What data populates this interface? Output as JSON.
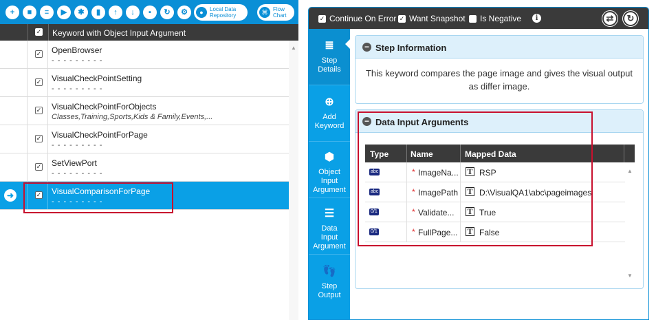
{
  "toolbar": {
    "buttons": [
      {
        "name": "add",
        "glyph": "+"
      },
      {
        "name": "record",
        "glyph": "■"
      },
      {
        "name": "list",
        "glyph": "≡"
      },
      {
        "name": "run",
        "glyph": "▶"
      },
      {
        "name": "debug",
        "glyph": "✱"
      },
      {
        "name": "delete",
        "glyph": "▮"
      },
      {
        "name": "move-up",
        "glyph": "↑"
      },
      {
        "name": "move-down",
        "glyph": "↓"
      },
      {
        "name": "save",
        "glyph": "▪"
      },
      {
        "name": "refresh",
        "glyph": "↻"
      },
      {
        "name": "settings",
        "glyph": "⚙"
      }
    ],
    "repository_label_1": "Local Data",
    "repository_label_2": "Repository",
    "flowchart_label_1": "Flow",
    "flowchart_label_2": "Chart"
  },
  "grid": {
    "header_checkbox": "✓",
    "header_label": "Keyword with Object Input Argument",
    "rows": [
      {
        "keyword": "OpenBrowser",
        "sub": "- - - - - - - - -",
        "checked": "✓"
      },
      {
        "keyword": "VisualCheckPointSetting",
        "sub": "- - - - - - - - -",
        "checked": "✓"
      },
      {
        "keyword": "VisualCheckPointForObjects",
        "sub": "Classes,Training,Sports,Kids & Family,Events,...",
        "checked": "✓"
      },
      {
        "keyword": "VisualCheckPointForPage",
        "sub": "- - - - - - - - -",
        "checked": "✓"
      },
      {
        "keyword": "SetViewPort",
        "sub": "- - - - - - - - -",
        "checked": "✓"
      },
      {
        "keyword": "VisualComparisonForPage",
        "sub": "- - - - - - - - -",
        "checked": "✓",
        "selected": true
      }
    ],
    "current_row_marker": "➜"
  },
  "options": {
    "continue_on_error": {
      "label": "Continue On Error",
      "check": "✓"
    },
    "want_snapshot": {
      "label": "Want Snapshot",
      "check": "✓"
    },
    "is_negative": {
      "label": "Is Negative",
      "check": ""
    },
    "info_glyph": "i",
    "swap_glyph": "⇄",
    "refresh_glyph": "↻"
  },
  "sidebar": {
    "items": [
      {
        "label_1": "Step",
        "label_2": "Details",
        "label_3": "",
        "icon": "≣"
      },
      {
        "label_1": "Add",
        "label_2": "Keyword",
        "label_3": "",
        "icon": "⊕"
      },
      {
        "label_1": "Object",
        "label_2": "Input",
        "label_3": "Argument",
        "icon": "⬢"
      },
      {
        "label_1": "Data",
        "label_2": "Input",
        "label_3": "Argument",
        "icon": "☰"
      },
      {
        "label_1": "Step",
        "label_2": "Output",
        "label_3": "",
        "icon": "👣"
      }
    ]
  },
  "step_info": {
    "title": "Step Information",
    "collapse_glyph": "−",
    "description": "This keyword compares the page image and gives the visual output as differ image."
  },
  "data_args": {
    "title": "Data Input Arguments",
    "collapse_glyph": "−",
    "columns": {
      "type": "Type",
      "name": "Name",
      "mapped": "Mapped Data"
    },
    "required_mark": "*",
    "text_type_glyph": "T",
    "rows": [
      {
        "type_badge": "abc",
        "name": "ImageNa...",
        "value": "RSP"
      },
      {
        "type_badge": "abc",
        "name": "ImagePath",
        "value": "D:\\VisualQA1\\abc\\pageimages"
      },
      {
        "type_badge": "0/1",
        "name": "Validate...",
        "value": "True"
      },
      {
        "type_badge": "0/1",
        "name": "FullPage...",
        "value": "False"
      }
    ]
  },
  "colors": {
    "accent": "#0aa0e6",
    "toolbar": "#0a8fd6",
    "header_dark": "#3a3a3a",
    "highlight_box": "#c8102e"
  }
}
